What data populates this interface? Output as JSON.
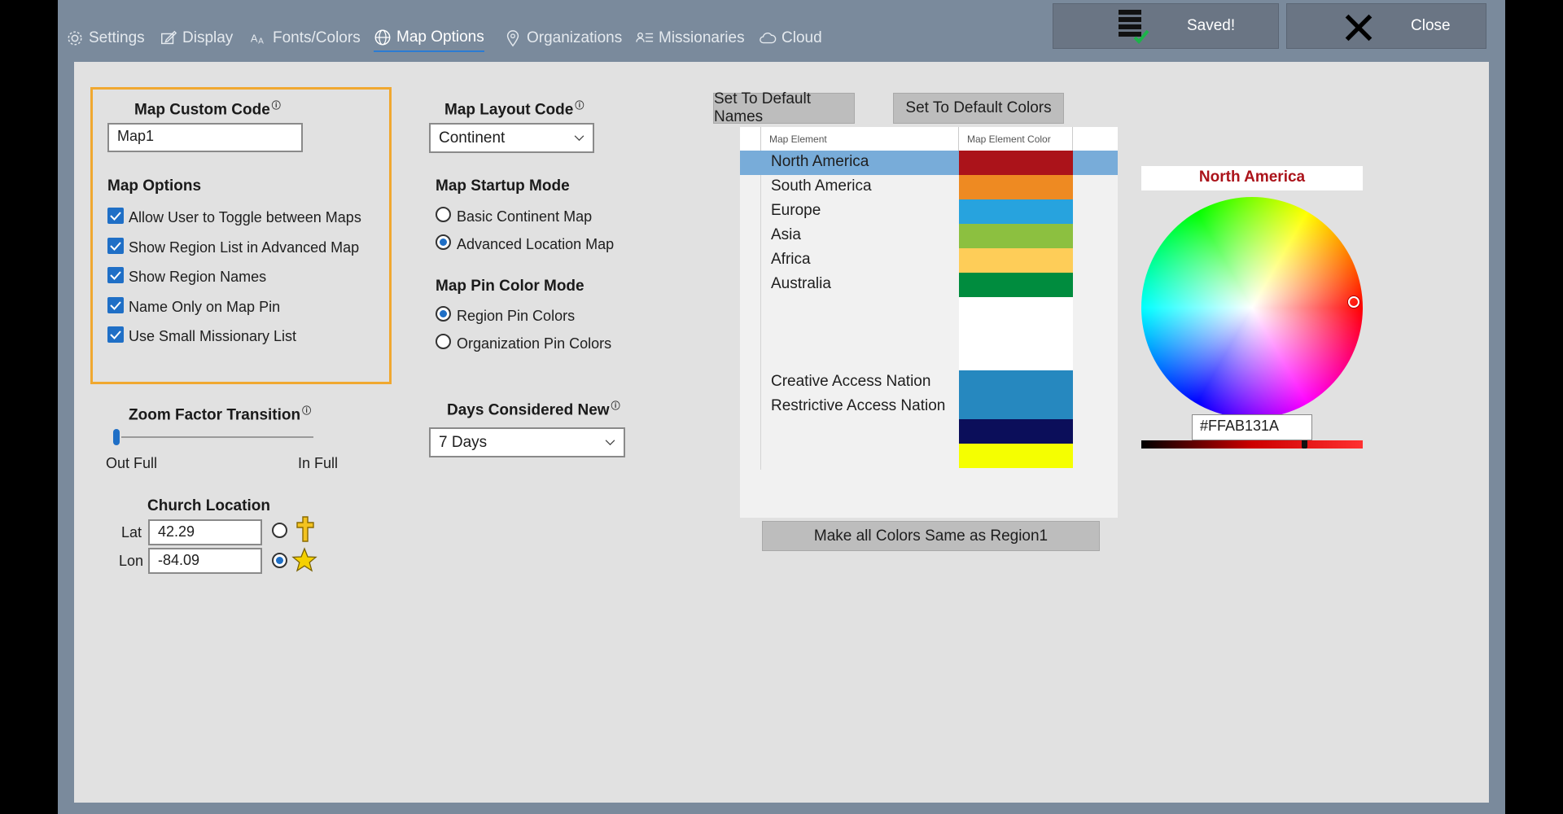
{
  "tabs": [
    {
      "label": "Settings",
      "icon": "gear-icon"
    },
    {
      "label": "Display",
      "icon": "display-edit-icon"
    },
    {
      "label": "Fonts/Colors",
      "icon": "font-icon"
    },
    {
      "label": "Map Options",
      "icon": "globe-icon",
      "active": true
    },
    {
      "label": "Organizations",
      "icon": "map-pin-icon"
    },
    {
      "label": "Missionaries",
      "icon": "people-list-icon"
    },
    {
      "label": "Cloud",
      "icon": "cloud-icon"
    }
  ],
  "toolbar": {
    "saved_label": "Saved!",
    "close_label": "Close"
  },
  "custom": {
    "title": "Map Custom Code",
    "code_value": "Map1",
    "options_title": "Map Options",
    "options": [
      {
        "label": "Allow User to Toggle between Maps",
        "checked": true
      },
      {
        "label": "Show Region List in Advanced Map",
        "checked": true
      },
      {
        "label": "Show Region Names",
        "checked": true
      },
      {
        "label": "Name Only on Map Pin",
        "checked": true
      },
      {
        "label": "Use Small Missionary List",
        "checked": true
      }
    ]
  },
  "zoom": {
    "title": "Zoom Factor Transition",
    "min_label": "Out Full",
    "max_label": "In Full",
    "value": 0.0
  },
  "church": {
    "title": "Church Location",
    "lat_label": "Lat",
    "lat_value": "42.29",
    "lon_label": "Lon",
    "lon_value": "-84.09"
  },
  "layout": {
    "title": "Map Layout Code",
    "value": "Continent"
  },
  "startup": {
    "title": "Map Startup Mode",
    "options": [
      {
        "label": "Basic Continent Map",
        "selected": false
      },
      {
        "label": "Advanced Location Map",
        "selected": true
      }
    ]
  },
  "pincolor": {
    "title": "Map Pin Color Mode",
    "options": [
      {
        "label": "Region Pin Colors",
        "selected": true
      },
      {
        "label": "Organization Pin Colors",
        "selected": false
      }
    ]
  },
  "daysnew": {
    "title": "Days Considered New",
    "value": "7 Days"
  },
  "grid": {
    "default_names_btn": "Set To Default Names",
    "default_colors_btn": "Set To Default Colors",
    "col_element": "Map Element",
    "col_color": "Map Element Color",
    "rows": [
      {
        "name": "North America",
        "color": "#ab131a"
      },
      {
        "name": "South America",
        "color": "#ee8a22"
      },
      {
        "name": "Europe",
        "color": "#27a3de"
      },
      {
        "name": "Asia",
        "color": "#8cc040"
      },
      {
        "name": "Africa",
        "color": "#fecd58"
      },
      {
        "name": "Australia",
        "color": "#008c3e"
      },
      {
        "name": "",
        "color": "#ffffff"
      },
      {
        "name": "",
        "color": "#ffffff"
      },
      {
        "name": "",
        "color": "#ffffff"
      },
      {
        "name": "Creative Access Nation",
        "color": "#2688bf"
      },
      {
        "name": "Restrictive Access Nation",
        "color": "#2688bf"
      },
      {
        "name": "",
        "color": "#0b0e5a"
      },
      {
        "name": "",
        "color": "#f5ff00"
      }
    ],
    "same_btn": "Make all Colors Same as Region1"
  },
  "picker": {
    "title": "North America",
    "title_color": "#ab131a",
    "hex_value": "#FFAB131A"
  },
  "colors": {
    "accent": "#2b7cd3",
    "highlight": "#f0a830",
    "selected_row": "#78acd9"
  }
}
